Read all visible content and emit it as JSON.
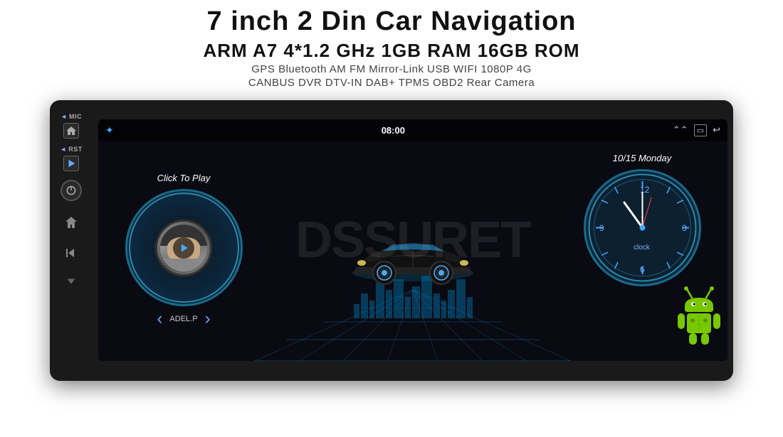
{
  "header": {
    "main_title": "7 inch 2 Din Car Navigation",
    "specs": "ARM A7 4*1.2 GHz    1GB RAM    16GB ROM",
    "features_row1": "GPS  Bluetooth  AM  FM  Mirror-Link  USB  WIFI  1080P  4G",
    "features_row2": "CANBUS  DVR  DTV-IN  DAB+  TPMS  OBD2  Rear Camera"
  },
  "screen": {
    "status_time": "08:00",
    "date_display": "10/15 Monday",
    "click_to_play": "Click To Play",
    "track_name": "ADEL.P",
    "clock_label": "clock",
    "watermark": "DSSURET",
    "prev_btn": "‹",
    "next_btn": "›"
  },
  "side_panel": {
    "mic_label": "MIC",
    "rst_label": "RST"
  },
  "icons": {
    "bluetooth": "✦",
    "arrow_up": "⌃",
    "screen": "▭",
    "back": "↩",
    "home": "⌂",
    "back_nav": "↩",
    "play": "▶",
    "power": "⏻"
  }
}
